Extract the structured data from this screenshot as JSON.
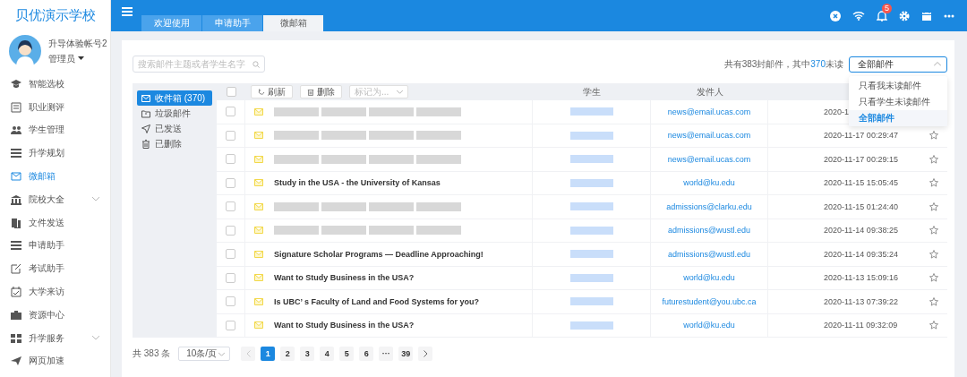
{
  "sidebar": {
    "school": "贝优演示学校",
    "user": {
      "name": "升导体验帐号2",
      "role": "管理员"
    },
    "items": [
      {
        "label": "智能选校",
        "kind": "cap",
        "selected": false,
        "expandable": false
      },
      {
        "label": "职业测评",
        "kind": "form",
        "selected": false,
        "expandable": false
      },
      {
        "label": "学生管理",
        "kind": "people",
        "selected": false,
        "expandable": false
      },
      {
        "label": "升学规划",
        "kind": "list",
        "selected": false,
        "expandable": false
      },
      {
        "label": "微邮箱",
        "kind": "mail",
        "selected": true,
        "expandable": false
      },
      {
        "label": "院校大全",
        "kind": "bank",
        "selected": false,
        "expandable": true
      },
      {
        "label": "文件发送",
        "kind": "file",
        "selected": false,
        "expandable": false
      },
      {
        "label": "申请助手",
        "kind": "list",
        "selected": false,
        "expandable": false
      },
      {
        "label": "考试助手",
        "kind": "edit",
        "selected": false,
        "expandable": false
      },
      {
        "label": "大学来访",
        "kind": "calendar",
        "selected": false,
        "expandable": false
      },
      {
        "label": "资源中心",
        "kind": "case",
        "selected": false,
        "expandable": false
      },
      {
        "label": "升学服务",
        "kind": "grid",
        "selected": false,
        "expandable": true
      },
      {
        "label": "网页加速",
        "kind": "plane",
        "selected": false,
        "expandable": false
      }
    ]
  },
  "tabs": [
    {
      "label": "欢迎使用",
      "selected": false
    },
    {
      "label": "申请助手",
      "selected": false
    },
    {
      "label": "微邮箱",
      "selected": true
    }
  ],
  "notification_count": "5",
  "search": {
    "placeholder": "搜索邮件主题或者学生名字"
  },
  "summary": {
    "prefix": "共有383封邮件，其中",
    "unread": "370",
    "suffix": "未读"
  },
  "filter": {
    "value": "全部邮件",
    "open": true,
    "options": [
      {
        "label": "只看我未读邮件",
        "selected": false
      },
      {
        "label": "只看学生未读邮件",
        "selected": false
      },
      {
        "label": "全部邮件",
        "selected": true
      }
    ]
  },
  "folders": [
    {
      "label": "收件箱 (370)",
      "kind": "inbox",
      "selected": true
    },
    {
      "label": "垃圾邮件",
      "kind": "junk",
      "selected": false
    },
    {
      "label": "已发送",
      "kind": "sent",
      "selected": false
    },
    {
      "label": "已删除",
      "kind": "deleted",
      "selected": false
    }
  ],
  "toolbar": {
    "all_checked": false,
    "refresh": "刷新",
    "delete": "删除",
    "mark_placeholder": "标记为..."
  },
  "columns": {
    "student": "学生",
    "sender": "发件人"
  },
  "rows": [
    {
      "checked": false,
      "subject_redacted": true,
      "sender": "news@email.ucas.com",
      "date": "2020-1",
      "star_icon": false
    },
    {
      "checked": false,
      "subject_redacted": true,
      "sender": "news@email.ucas.com",
      "date": "2020-11-17 00:29:47",
      "star_icon": true
    },
    {
      "checked": false,
      "subject_redacted": true,
      "sender": "news@email.ucas.com",
      "date": "2020-11-17 00:29:15",
      "star_icon": true
    },
    {
      "checked": false,
      "subject_redacted": false,
      "subject": "Study in the USA - the University of Kansas",
      "sender": "world@ku.edu",
      "date": "2020-11-15 15:05:45",
      "star_icon": true
    },
    {
      "checked": false,
      "subject_redacted": true,
      "sender": "admissions@clarku.edu",
      "date": "2020-11-15 01:24:40",
      "star_icon": true
    },
    {
      "checked": false,
      "subject_redacted": true,
      "sender": "admissions@wustl.edu",
      "date": "2020-11-14 09:38:25",
      "star_icon": true
    },
    {
      "checked": false,
      "subject_redacted": false,
      "subject": "Signature Scholar Programs — Deadline Approaching!",
      "sender": "admissions@wustl.edu",
      "date": "2020-11-14 09:35:24",
      "star_icon": true
    },
    {
      "checked": false,
      "subject_redacted": false,
      "subject": "Want to Study Business in the USA?",
      "sender": "world@ku.edu",
      "date": "2020-11-13 15:09:16",
      "star_icon": true
    },
    {
      "checked": false,
      "subject_redacted": false,
      "subject": "Is UBC’ s Faculty of Land and Food Systems for you?",
      "sender": "futurestudent@you.ubc.ca",
      "date": "2020-11-13 07:39:22",
      "star_icon": true
    },
    {
      "checked": false,
      "subject_redacted": false,
      "subject": "Want to Study Business in the USA?",
      "sender": "world@ku.edu",
      "date": "2020-11-11 09:32:09",
      "star_icon": true
    }
  ],
  "pagination": {
    "total": "共 383 条",
    "page_size": "10条/页",
    "pages": [
      {
        "label": "1",
        "selected": true
      },
      {
        "label": "2",
        "selected": false
      },
      {
        "label": "3",
        "selected": false
      },
      {
        "label": "4",
        "selected": false
      },
      {
        "label": "5",
        "selected": false
      },
      {
        "label": "6",
        "selected": false
      },
      {
        "label": "···",
        "selected": false
      },
      {
        "label": "39",
        "selected": false
      }
    ]
  }
}
